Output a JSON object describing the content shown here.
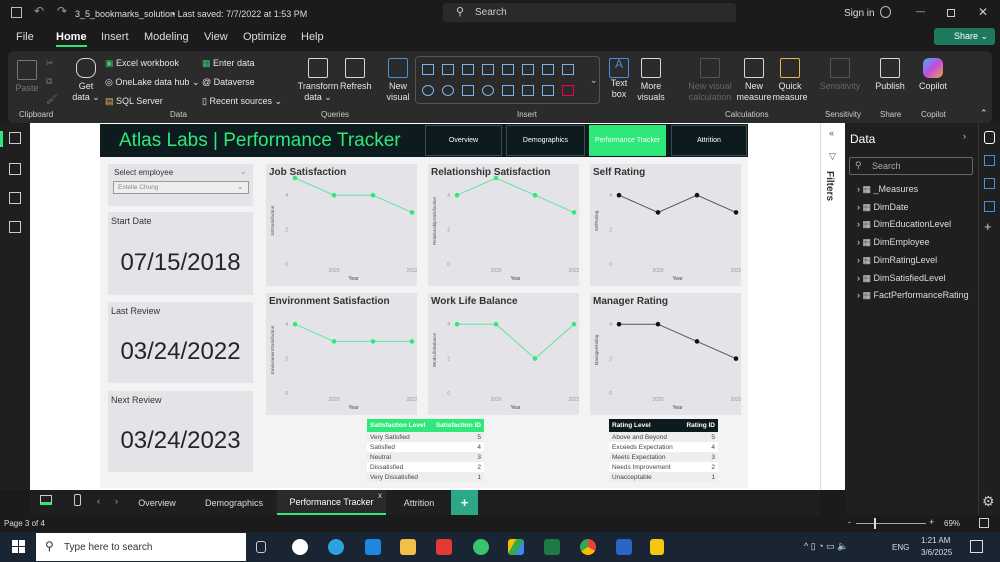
{
  "titlebar": {
    "filename": "3_5_bookmarks_solution",
    "saved": "• Last saved: 7/7/2022 at 1:53 PM",
    "search": "Search",
    "sign_in": "Sign in"
  },
  "menu": {
    "items": [
      "File",
      "Home",
      "Insert",
      "Modeling",
      "View",
      "Optimize",
      "Help"
    ],
    "share": "Share"
  },
  "ribbon": {
    "paste": "Paste",
    "get_data": "Get data",
    "excel": "Excel workbook",
    "onelake": "OneLake data hub",
    "sql": "SQL Server",
    "enter_data": "Enter data",
    "dataverse": "Dataverse",
    "recent": "Recent sources",
    "transform": "Transform data",
    "refresh": "Refresh",
    "new_visual": "New visual",
    "text_box": "Text box",
    "more_visuals": "More visuals",
    "new_visual_calc": "New visual calculation",
    "new_measure": "New measure",
    "quick_measure": "Quick measure",
    "sensitivity": "Sensitivity",
    "publish": "Publish",
    "copilot": "Copilot",
    "groups": [
      "Clipboard",
      "Data",
      "Queries",
      "Insert",
      "Calculations",
      "Sensitivity",
      "Share",
      "Copilot"
    ]
  },
  "report": {
    "title": "Atlas Labs | Performance Tracker",
    "nav": [
      "Overview",
      "Demographics",
      "Performance Tracker",
      "Attrition"
    ],
    "slicer_label": "Select employee",
    "slicer_value": "Estelle Chung",
    "cards": [
      {
        "label": "Start Date",
        "value": "07/15/2018"
      },
      {
        "label": "Last Review",
        "value": "03/24/2022"
      },
      {
        "label": "Next Review",
        "value": "03/24/2023"
      }
    ]
  },
  "chart_data": [
    {
      "type": "line",
      "title": "Job Satisfaction",
      "ylabel": "JobSatisfaction",
      "xlabel": "Year",
      "x": [
        2019,
        2020,
        2021,
        2022
      ],
      "values": [
        5,
        4,
        4,
        3
      ],
      "color": "#2ee87a",
      "ylim": [
        0,
        5
      ],
      "yticks": [
        "0",
        "2",
        "4"
      ],
      "xticks": [
        "2020",
        "2022"
      ]
    },
    {
      "type": "line",
      "title": "Relationship Satisfaction",
      "ylabel": "RelationshipSatisfaction",
      "xlabel": "Year",
      "x": [
        2019,
        2020,
        2021,
        2022
      ],
      "values": [
        4,
        5,
        4,
        3
      ],
      "color": "#2ee87a",
      "ylim": [
        0,
        5
      ],
      "yticks": [
        "0",
        "2",
        "4"
      ],
      "xticks": [
        "2020",
        "2022"
      ]
    },
    {
      "type": "line",
      "title": "Self Rating",
      "ylabel": "SelfRating",
      "xlabel": "Year",
      "x": [
        2019,
        2020,
        2021,
        2022
      ],
      "values": [
        4,
        3,
        4,
        3
      ],
      "color": "#111111",
      "ylim": [
        0,
        5
      ],
      "yticks": [
        "0",
        "2",
        "4"
      ],
      "xticks": [
        "2020",
        "2022"
      ]
    },
    {
      "type": "line",
      "title": "Environment Satisfaction",
      "ylabel": "EnvironmentSatisfaction",
      "xlabel": "Year",
      "x": [
        2019,
        2020,
        2021,
        2022
      ],
      "values": [
        4,
        3,
        3,
        3
      ],
      "color": "#2ee87a",
      "ylim": [
        0,
        5
      ],
      "yticks": [
        "0",
        "2",
        "4"
      ],
      "xticks": [
        "2020",
        "2022"
      ]
    },
    {
      "type": "line",
      "title": "Work Life Balance",
      "ylabel": "WorkLifeBalance",
      "xlabel": "Year",
      "x": [
        2019,
        2020,
        2021,
        2022
      ],
      "values": [
        4,
        4,
        2,
        4
      ],
      "color": "#2ee87a",
      "ylim": [
        0,
        5
      ],
      "yticks": [
        "0",
        "2",
        "4"
      ],
      "xticks": [
        "2020",
        "2022"
      ]
    },
    {
      "type": "line",
      "title": "Manager Rating",
      "ylabel": "ManagerRating",
      "xlabel": "Year",
      "x": [
        2019,
        2020,
        2021,
        2022
      ],
      "values": [
        4,
        4,
        3,
        2
      ],
      "color": "#111111",
      "ylim": [
        0,
        5
      ],
      "yticks": [
        "0",
        "2",
        "4"
      ],
      "xticks": [
        "2020",
        "2022"
      ]
    }
  ],
  "sat_table": {
    "headers": [
      "Satisfaction Level",
      "Satisfaction ID"
    ],
    "rows": [
      [
        "Very Satisfied",
        "5"
      ],
      [
        "Satisfied",
        "4"
      ],
      [
        "Neutral",
        "3"
      ],
      [
        "Dissatisfied",
        "2"
      ],
      [
        "Very Dissatisfied",
        "1"
      ]
    ]
  },
  "rating_table": {
    "headers": [
      "Rating Level",
      "Rating ID"
    ],
    "rows": [
      [
        "Above and Beyond",
        "5"
      ],
      [
        "Exceeds Expectation",
        "4"
      ],
      [
        "Meets Expectation",
        "3"
      ],
      [
        "Needs Improvement",
        "2"
      ],
      [
        "Unacceptable",
        "1"
      ]
    ]
  },
  "filters_label": "Filters",
  "data_pane": {
    "title": "Data",
    "search_placeholder": "Search",
    "fields": [
      "_Measures",
      "DimDate",
      "DimEducationLevel",
      "DimEmployee",
      "DimRatingLevel",
      "DimSatisfiedLevel",
      "FactPerformanceRating"
    ]
  },
  "page_tabs": [
    "Overview",
    "Demographics",
    "Performance Tracker",
    "Attrition"
  ],
  "status": {
    "page": "Page 3 of 4",
    "zoom": "69%",
    "zoom_fraction": 0.69
  },
  "taskbar": {
    "search": "Type here to search",
    "lang": "ENG",
    "time": "1:21 AM",
    "date": "3/6/2025"
  },
  "colors": {
    "accent": "#2ee87a",
    "header": "#0d1b1f",
    "share": "#1e7a5e"
  }
}
